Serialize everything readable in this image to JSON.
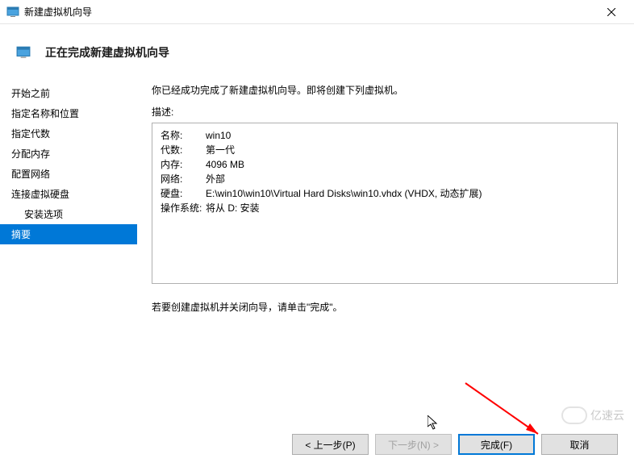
{
  "window": {
    "title": "新建虚拟机向导"
  },
  "header": {
    "title": "正在完成新建虚拟机向导"
  },
  "sidebar": {
    "items": [
      {
        "label": "开始之前"
      },
      {
        "label": "指定名称和位置"
      },
      {
        "label": "指定代数"
      },
      {
        "label": "分配内存"
      },
      {
        "label": "配置网络"
      },
      {
        "label": "连接虚拟硬盘"
      },
      {
        "label": "安装选项"
      },
      {
        "label": "摘要"
      }
    ]
  },
  "main": {
    "intro": "你已经成功完成了新建虚拟机向导。即将创建下列虚拟机。",
    "desc_label": "描述:",
    "summary": [
      {
        "key": "名称:",
        "val": "win10"
      },
      {
        "key": "代数:",
        "val": "第一代"
      },
      {
        "key": "内存:",
        "val": "4096 MB"
      },
      {
        "key": "网络:",
        "val": "外部"
      },
      {
        "key": "硬盘:",
        "val": "E:\\win10\\win10\\Virtual Hard Disks\\win10.vhdx (VHDX, 动态扩展)"
      },
      {
        "key": "操作系统:",
        "val": "将从 D: 安装"
      }
    ],
    "footer": "若要创建虚拟机并关闭向导，请单击\"完成\"。"
  },
  "buttons": {
    "prev": "< 上一步(P)",
    "next": "下一步(N) >",
    "finish": "完成(F)",
    "cancel": "取消"
  },
  "watermark": "亿速云"
}
